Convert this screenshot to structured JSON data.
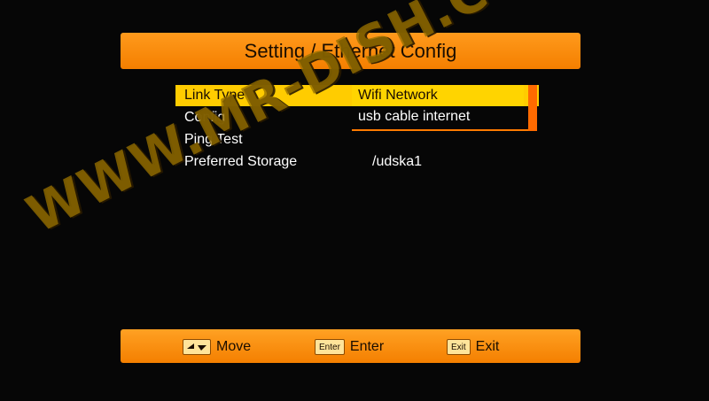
{
  "header": {
    "title": "Setting / Ethernet Config"
  },
  "menu": {
    "items": [
      {
        "label": "Link Type",
        "value": "Wifi Network"
      },
      {
        "label": "Config",
        "value": "usb cable internet"
      },
      {
        "label": "Ping Test",
        "value": ""
      },
      {
        "label": "Preferred Storage",
        "value": "/udska1"
      }
    ]
  },
  "footer": {
    "move_key": "",
    "move_label": "Move",
    "enter_key": "Enter",
    "enter_label": "Enter",
    "exit_key": "Exit",
    "exit_label": "Exit"
  },
  "watermark": {
    "text": "WWW.MR-DISH.COM"
  },
  "colors": {
    "bar_orange": "#f58a0a",
    "highlight_yellow": "#ffcc00",
    "accent_orange": "#ff6a00",
    "background": "#060606"
  },
  "icons": {
    "move": "up-down-arrows-icon",
    "enter": "enter-key-icon",
    "exit": "exit-key-icon"
  }
}
